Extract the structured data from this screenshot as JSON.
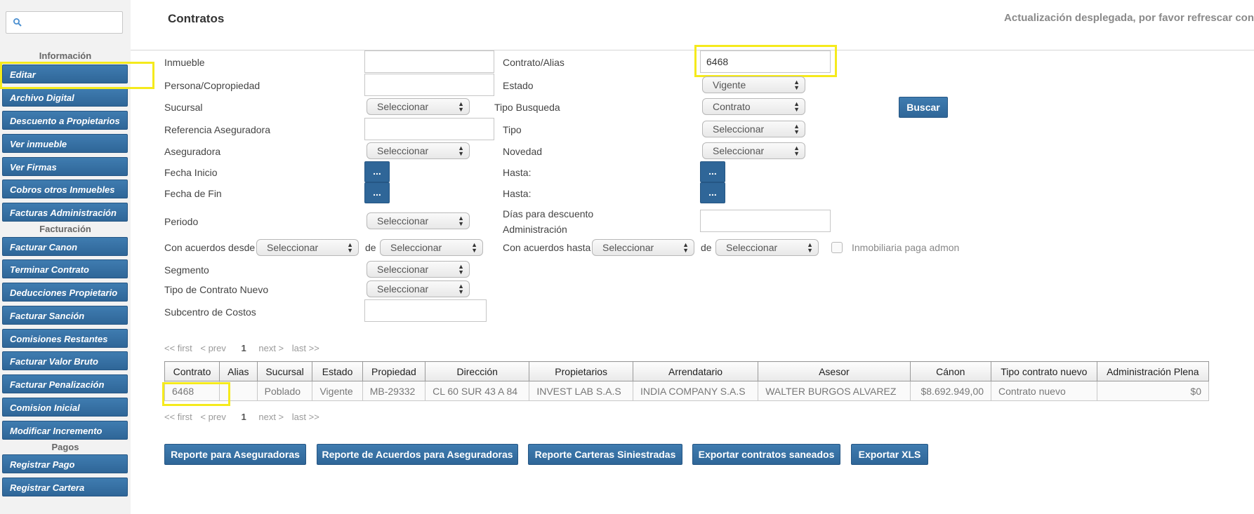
{
  "sidebar": {
    "search": {
      "value": "",
      "placeholder": ""
    },
    "sections": {
      "informacion": "Información",
      "facturacion": "Facturación",
      "pagos": "Pagos"
    },
    "items": [
      "Editar",
      "Archivo Digital",
      "Descuento a Propietarios",
      "Ver inmueble",
      "Ver Firmas",
      "Cobros otros Inmuebles",
      "Facturas Administración",
      "Facturar Canon",
      "Terminar Contrato",
      "Deducciones Propietario",
      "Facturar Sanción",
      "Comisiones Restantes",
      "Facturar Valor Bruto",
      "Facturar Penalización",
      "Comision Inicial",
      "Modificar Incremento",
      "Registrar Pago",
      "Registrar Cartera"
    ]
  },
  "header": {
    "title": "Contratos",
    "notice": "Actualización desplegada, por favor refrescar con"
  },
  "form": {
    "inmueble": {
      "label": "Inmueble",
      "value": ""
    },
    "persona": {
      "label": "Persona/Copropiedad",
      "value": ""
    },
    "sucursal": {
      "label": "Sucursal",
      "value": "Seleccionar"
    },
    "referencia": {
      "label": "Referencia Aseguradora",
      "value": ""
    },
    "aseguradora": {
      "label": "Aseguradora",
      "value": "Seleccionar"
    },
    "fecha_inicio": {
      "label": "Fecha Inicio",
      "button": "..."
    },
    "fecha_fin": {
      "label": "Fecha de Fin",
      "button": "..."
    },
    "periodo": {
      "label": "Periodo",
      "value": "Seleccionar"
    },
    "con_acuerdos_desde": {
      "label": "Con acuerdos desde",
      "value1": "Seleccionar",
      "de": "de",
      "value2": "Seleccionar"
    },
    "segmento": {
      "label": "Segmento",
      "value": "Seleccionar"
    },
    "tipo_contrato_nuevo": {
      "label": "Tipo de Contrato Nuevo",
      "value": "Seleccionar"
    },
    "subcentro": {
      "label": "Subcentro de Costos",
      "value": ""
    },
    "contrato_alias": {
      "label": "Contrato/Alias",
      "value": "6468"
    },
    "estado": {
      "label": "Estado",
      "value": "Vigente"
    },
    "tipo_busqueda": {
      "label": "Tipo Busqueda",
      "value": "Contrato"
    },
    "tipo": {
      "label": "Tipo",
      "value": "Seleccionar"
    },
    "novedad": {
      "label": "Novedad",
      "value": "Seleccionar"
    },
    "hasta1": {
      "label": "Hasta:",
      "button": "..."
    },
    "hasta2": {
      "label": "Hasta:",
      "button": "..."
    },
    "dias_descuento": {
      "label_line1": "Días para descuento",
      "label_line2": "Administración",
      "value": ""
    },
    "con_acuerdos_hasta": {
      "label": "Con acuerdos hasta",
      "value1": "Seleccionar",
      "de": "de",
      "value2": "Seleccionar"
    },
    "inmobiliaria_paga": {
      "label": "Inmobiliaria paga admon",
      "checked": false
    },
    "buscar": "Buscar"
  },
  "pager": {
    "first": "<< first",
    "prev": "< prev",
    "current": "1",
    "next": "next >",
    "last": "last >>"
  },
  "table": {
    "headers": [
      "Contrato",
      "Alias",
      "Sucursal",
      "Estado",
      "Propiedad",
      "Dirección",
      "Propietarios",
      "Arrendatario",
      "Asesor",
      "Cánon",
      "Tipo contrato nuevo",
      "Administración Plena"
    ],
    "rows": [
      [
        "6468",
        "",
        "Poblado",
        "Vigente",
        "MB-29332",
        "CL 60 SUR 43 A 84",
        "INVEST LAB S.A.S",
        "INDIA COMPANY S.A.S",
        "WALTER BURGOS ALVAREZ",
        "$8.692.949,00",
        "Contrato nuevo",
        "$0"
      ]
    ]
  },
  "actions": {
    "reporte_aseguradoras": "Reporte para Aseguradoras",
    "reporte_acuerdos": "Reporte de Acuerdos para Aseguradoras",
    "reporte_carteras": "Reporte Carteras Siniestradas",
    "exportar_saneados": "Exportar contratos saneados",
    "exportar_xls": "Exportar XLS"
  },
  "colors": {
    "accent": "#2f6698",
    "highlight": "#f5ea1c"
  }
}
